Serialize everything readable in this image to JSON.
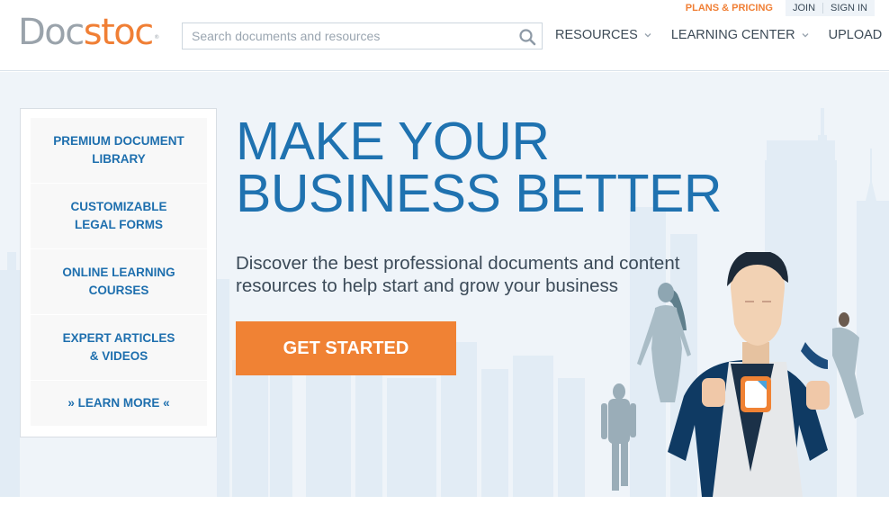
{
  "header": {
    "logo": {
      "part1": "Doc",
      "part2": "stoc",
      "registered": "®"
    },
    "search": {
      "placeholder": "Search documents and resources",
      "value": "",
      "icon": "search-icon"
    },
    "topbar": {
      "plans_pricing": "PLANS & PRICING",
      "join": "JOIN",
      "sign_in": "SIGN IN"
    },
    "nav": [
      {
        "label": "RESOURCES",
        "has_dropdown": true
      },
      {
        "label": "LEARNING CENTER",
        "has_dropdown": true
      },
      {
        "label": "UPLOAD",
        "has_dropdown": false
      }
    ]
  },
  "sidebar": {
    "items": [
      {
        "line1": "PREMIUM DOCUMENT",
        "line2": "LIBRARY"
      },
      {
        "line1": "CUSTOMIZABLE",
        "line2": "LEGAL FORMS"
      },
      {
        "line1": "ONLINE LEARNING",
        "line2": "COURSES"
      },
      {
        "line1": "EXPERT ARTICLES",
        "line2": "& VIDEOS"
      },
      {
        "line1": "» LEARN MORE «",
        "line2": ""
      }
    ]
  },
  "hero": {
    "headline_line1": "MAKE YOUR",
    "headline_line2": "BUSINESS BETTER",
    "subtext_line1": "Discover the best professional documents and content",
    "subtext_line2": "resources to help start and grow your business",
    "cta_label": "GET STARTED"
  },
  "colors": {
    "brand_orange": "#f07f35",
    "brand_blue": "#1f72b0",
    "logo_gray": "#9aa3ab",
    "hero_bg": "#eff4f9",
    "suit_navy": "#0f3a63"
  }
}
